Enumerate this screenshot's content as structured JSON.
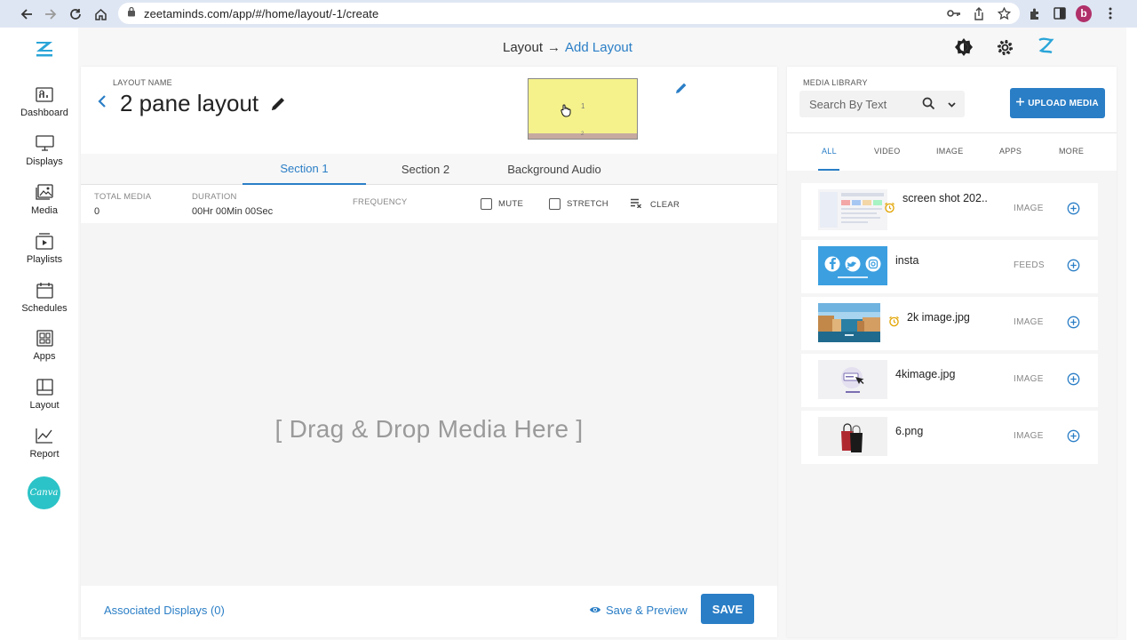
{
  "browser": {
    "url": "zeetaminds.com/app/#/home/layout/-1/create",
    "profile_initial": "b"
  },
  "sidebar": {
    "items": [
      {
        "label": "Dashboard",
        "icon": "dashboard-icon"
      },
      {
        "label": "Displays",
        "icon": "monitor-icon"
      },
      {
        "label": "Media",
        "icon": "image-icon"
      },
      {
        "label": "Playlists",
        "icon": "playlist-icon"
      },
      {
        "label": "Schedules",
        "icon": "calendar-icon"
      },
      {
        "label": "Apps",
        "icon": "apps-icon"
      },
      {
        "label": "Layout",
        "icon": "layout-icon"
      },
      {
        "label": "Report",
        "icon": "chart-icon"
      }
    ],
    "canva_label": "Canva"
  },
  "header": {
    "breadcrumb_parent": "Layout",
    "breadcrumb_arrow": "→",
    "breadcrumb_current": "Add Layout"
  },
  "layout": {
    "name_label": "LAYOUT NAME",
    "name": "2 pane layout",
    "preview_pane1": "1",
    "preview_pane2": "2"
  },
  "tabs": [
    "Section 1",
    "Section 2",
    "Background Audio"
  ],
  "stats": {
    "total_media_label": "TOTAL MEDIA",
    "total_media_value": "0",
    "duration_label": "DURATION",
    "duration_value": "00Hr 00Min 00Sec",
    "frequency_label": "FREQUENCY",
    "mute_label": "MUTE",
    "stretch_label": "STRETCH",
    "clear_label": "CLEAR"
  },
  "drop_zone_text": "[ Drag & Drop Media Here ]",
  "footer": {
    "associated_displays": "Associated Displays (0)",
    "save_preview": "Save & Preview",
    "save": "SAVE"
  },
  "media_library": {
    "label": "MEDIA LIBRARY",
    "search_placeholder": "Search By Text",
    "upload_label": "UPLOAD MEDIA",
    "tabs": [
      "ALL",
      "VIDEO",
      "IMAGE",
      "APPS",
      "MORE"
    ],
    "items": [
      {
        "name": "screen shot 202..",
        "type": "IMAGE",
        "scheduled": true
      },
      {
        "name": "insta",
        "type": "FEEDS",
        "scheduled": false
      },
      {
        "name": "2k image.jpg",
        "type": "IMAGE",
        "scheduled": true
      },
      {
        "name": "4kimage.jpg",
        "type": "IMAGE",
        "scheduled": false
      },
      {
        "name": "6.png",
        "type": "IMAGE",
        "scheduled": false
      }
    ]
  },
  "colors": {
    "accent": "#2a7ec6",
    "preview_pane1": "#f5f28b",
    "preview_pane2": "#c6aaa0",
    "canva": "#2bc3c7",
    "profile": "#b0306a"
  }
}
